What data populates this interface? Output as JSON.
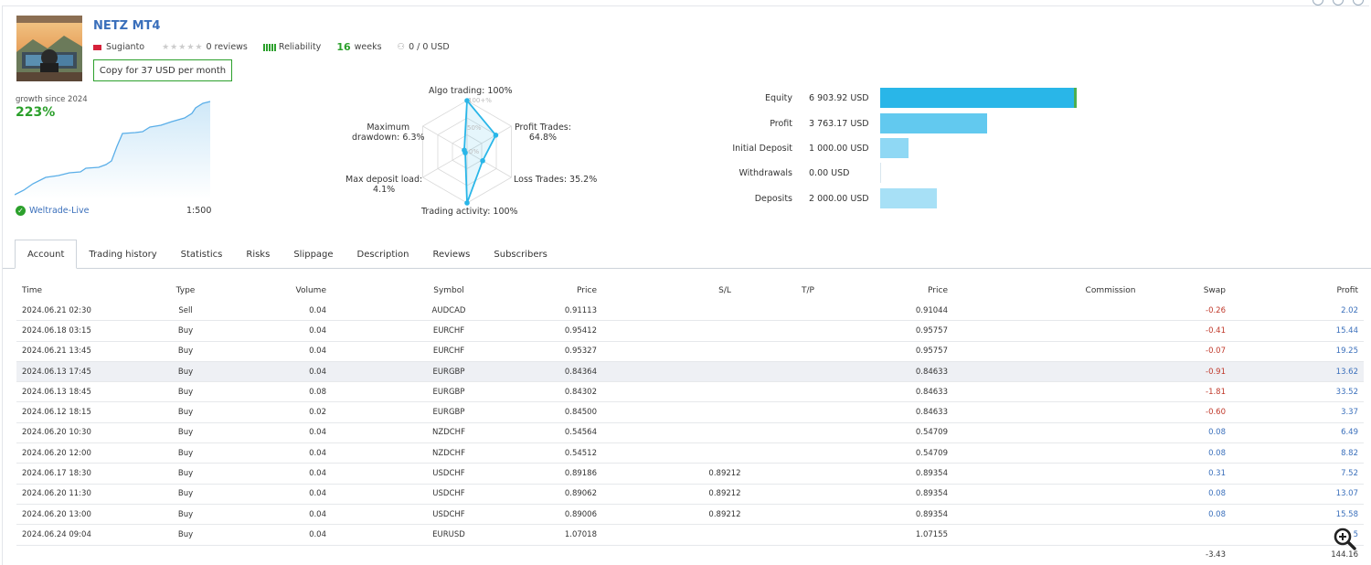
{
  "header": {
    "title": "NETZ MT4",
    "author": "Sugianto",
    "reviews": "0 reviews",
    "reliability": "Reliability",
    "weeks_number": "16",
    "weeks_label": "weeks",
    "subscribers": "0 / 0 USD",
    "copy_button": "Copy for 37 USD per month"
  },
  "growth": {
    "label": "growth since 2024",
    "value": "223%",
    "broker": "Weltrade-Live",
    "leverage": "1:500"
  },
  "radar": {
    "algo": "Algo trading: 100%",
    "profit_trades_1": "Profit Trades:",
    "profit_trades_2": "64.8%",
    "loss_trades": "Loss Trades: 35.2%",
    "activity": "Trading activity: 100%",
    "max_deposit_1": "Max deposit load:",
    "max_deposit_2": "4.1%",
    "max_dd_1": "Maximum",
    "max_dd_2": "drawdown: 6.3%",
    "scale_100": "100+%",
    "scale_50": "50%",
    "scale_0": "0%",
    "values": {
      "algo": 100,
      "profit": 64.8,
      "loss": 35.2,
      "activity": 100,
      "deposit_load": 4.1,
      "drawdown": 6.3
    }
  },
  "financials": [
    {
      "label": "Equity",
      "value": "6 903.92 USD",
      "amount": 6903.92,
      "color": "#29b6e8"
    },
    {
      "label": "Profit",
      "value": "3 763.17 USD",
      "amount": 3763.17,
      "color": "#62c9ef"
    },
    {
      "label": "Initial Deposit",
      "value": "1 000.00 USD",
      "amount": 1000.0,
      "color": "#8fd8f4"
    },
    {
      "label": "Withdrawals",
      "value": "0.00 USD",
      "amount": 0.0,
      "color": "#8fd8f4"
    },
    {
      "label": "Deposits",
      "value": "2 000.00 USD",
      "amount": 2000.0,
      "color": "#a7e0f6"
    }
  ],
  "tabs": [
    "Account",
    "Trading history",
    "Statistics",
    "Risks",
    "Slippage",
    "Description",
    "Reviews",
    "Subscribers"
  ],
  "table": {
    "columns": [
      "Time",
      "Type",
      "Volume",
      "Symbol",
      "Price",
      "S/L",
      "T/P",
      "Price",
      "Commission",
      "Swap",
      "Profit"
    ],
    "rows": [
      [
        "2024.06.21 02:30",
        "Sell",
        "0.04",
        "AUDCAD",
        "0.91113",
        "",
        "",
        "0.91044",
        "",
        "-0.26",
        "2.02"
      ],
      [
        "2024.06.18 03:15",
        "Buy",
        "0.04",
        "EURCHF",
        "0.95412",
        "",
        "",
        "0.95757",
        "",
        "-0.41",
        "15.44"
      ],
      [
        "2024.06.21 13:45",
        "Buy",
        "0.04",
        "EURCHF",
        "0.95327",
        "",
        "",
        "0.95757",
        "",
        "-0.07",
        "19.25"
      ],
      [
        "2024.06.13 17:45",
        "Buy",
        "0.04",
        "EURGBP",
        "0.84364",
        "",
        "",
        "0.84633",
        "",
        "-0.91",
        "13.62"
      ],
      [
        "2024.06.13 18:45",
        "Buy",
        "0.08",
        "EURGBP",
        "0.84302",
        "",
        "",
        "0.84633",
        "",
        "-1.81",
        "33.52"
      ],
      [
        "2024.06.12 18:15",
        "Buy",
        "0.02",
        "EURGBP",
        "0.84500",
        "",
        "",
        "0.84633",
        "",
        "-0.60",
        "3.37"
      ],
      [
        "2024.06.20 10:30",
        "Buy",
        "0.04",
        "NZDCHF",
        "0.54564",
        "",
        "",
        "0.54709",
        "",
        "0.08",
        "6.49"
      ],
      [
        "2024.06.20 12:00",
        "Buy",
        "0.04",
        "NZDCHF",
        "0.54512",
        "",
        "",
        "0.54709",
        "",
        "0.08",
        "8.82"
      ],
      [
        "2024.06.17 18:30",
        "Buy",
        "0.04",
        "USDCHF",
        "0.89186",
        "0.89212",
        "",
        "0.89354",
        "",
        "0.31",
        "7.52"
      ],
      [
        "2024.06.20 11:30",
        "Buy",
        "0.04",
        "USDCHF",
        "0.89062",
        "0.89212",
        "",
        "0.89354",
        "",
        "0.08",
        "13.07"
      ],
      [
        "2024.06.20 13:00",
        "Buy",
        "0.04",
        "USDCHF",
        "0.89006",
        "0.89212",
        "",
        "0.89354",
        "",
        "0.08",
        "15.58"
      ],
      [
        "2024.06.24 09:04",
        "Buy",
        "0.04",
        "EURUSD",
        "1.07018",
        "",
        "",
        "1.07155",
        "",
        "",
        "5"
      ]
    ],
    "totals": {
      "swap": "-3.43",
      "profit": "144.16"
    }
  }
}
